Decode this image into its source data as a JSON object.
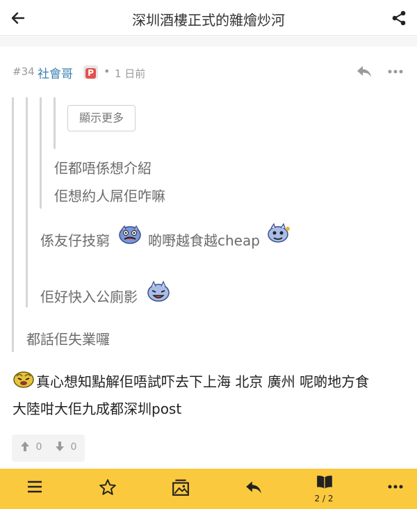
{
  "header": {
    "title": "深圳酒樓正式的雜燴炒河"
  },
  "post": {
    "number": "#34",
    "author": "社會哥",
    "badge": "P",
    "separator": "•",
    "time": "1 日前"
  },
  "quote": {
    "show_more_label": "顯示更多",
    "level3_line1": "佢都唔係想介紹",
    "level3_line2": "佢想約人屌佢咋嘛",
    "level2_line1_a": "係友仔技窮",
    "level2_line1_b": "啲嘢越食越cheap",
    "level2_line2": "佢好快入公廁影",
    "level1_line1": "都話佢失業囉"
  },
  "content": {
    "line1": "真心想知點解佢唔試吓去下上海 北京 廣州 呢啲地方食",
    "line2": "大陸咁大佢九成都深圳post"
  },
  "votes": {
    "up": "0",
    "down": "0"
  },
  "bottom_bar": {
    "page_indicator": "2 / 2"
  },
  "colors": {
    "accent": "#fbc93d",
    "author": "#3b7fb0",
    "badge_p": "#e4514f"
  }
}
